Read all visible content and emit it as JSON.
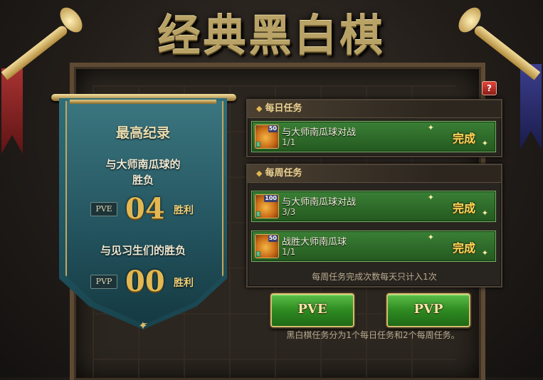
{
  "title": "经典黑白棋",
  "help_icon": "?",
  "record": {
    "title": "最高纪录",
    "pve": {
      "subtitle_line1": "与大师南瓜球的",
      "subtitle_line2": "胜负",
      "mode_tag": "PVE",
      "score": "04",
      "unit": "胜利"
    },
    "pvp": {
      "subtitle": "与见习生们的胜负",
      "mode_tag": "PVP",
      "score": "00",
      "unit": "胜利"
    }
  },
  "daily": {
    "header": "每日任务",
    "tasks": [
      {
        "icon_value": "50",
        "name": "与大师南瓜球对战",
        "progress": "1/1",
        "status": "完成"
      }
    ]
  },
  "weekly": {
    "header": "每周任务",
    "tasks": [
      {
        "icon_value": "100",
        "name": "与大师南瓜球对战",
        "progress": "3/3",
        "status": "完成"
      },
      {
        "icon_value": "50",
        "name": "战胜大师南瓜球",
        "progress": "1/1",
        "status": "完成"
      }
    ],
    "note": "每周任务完成次数每天只计入1次"
  },
  "buttons": {
    "pve": "PVE",
    "pvp": "PVP"
  },
  "footer_note": "黑白棋任务分为1个每日任务和2个每周任务。",
  "icons": {
    "task_reward": "pumpkin-coin-icon",
    "help": "help-icon",
    "sparkle": "sparkle-icon"
  },
  "colors": {
    "task_green": "#2f7a2a",
    "gold": "#e3b852",
    "banner_teal": "#2a6570"
  }
}
